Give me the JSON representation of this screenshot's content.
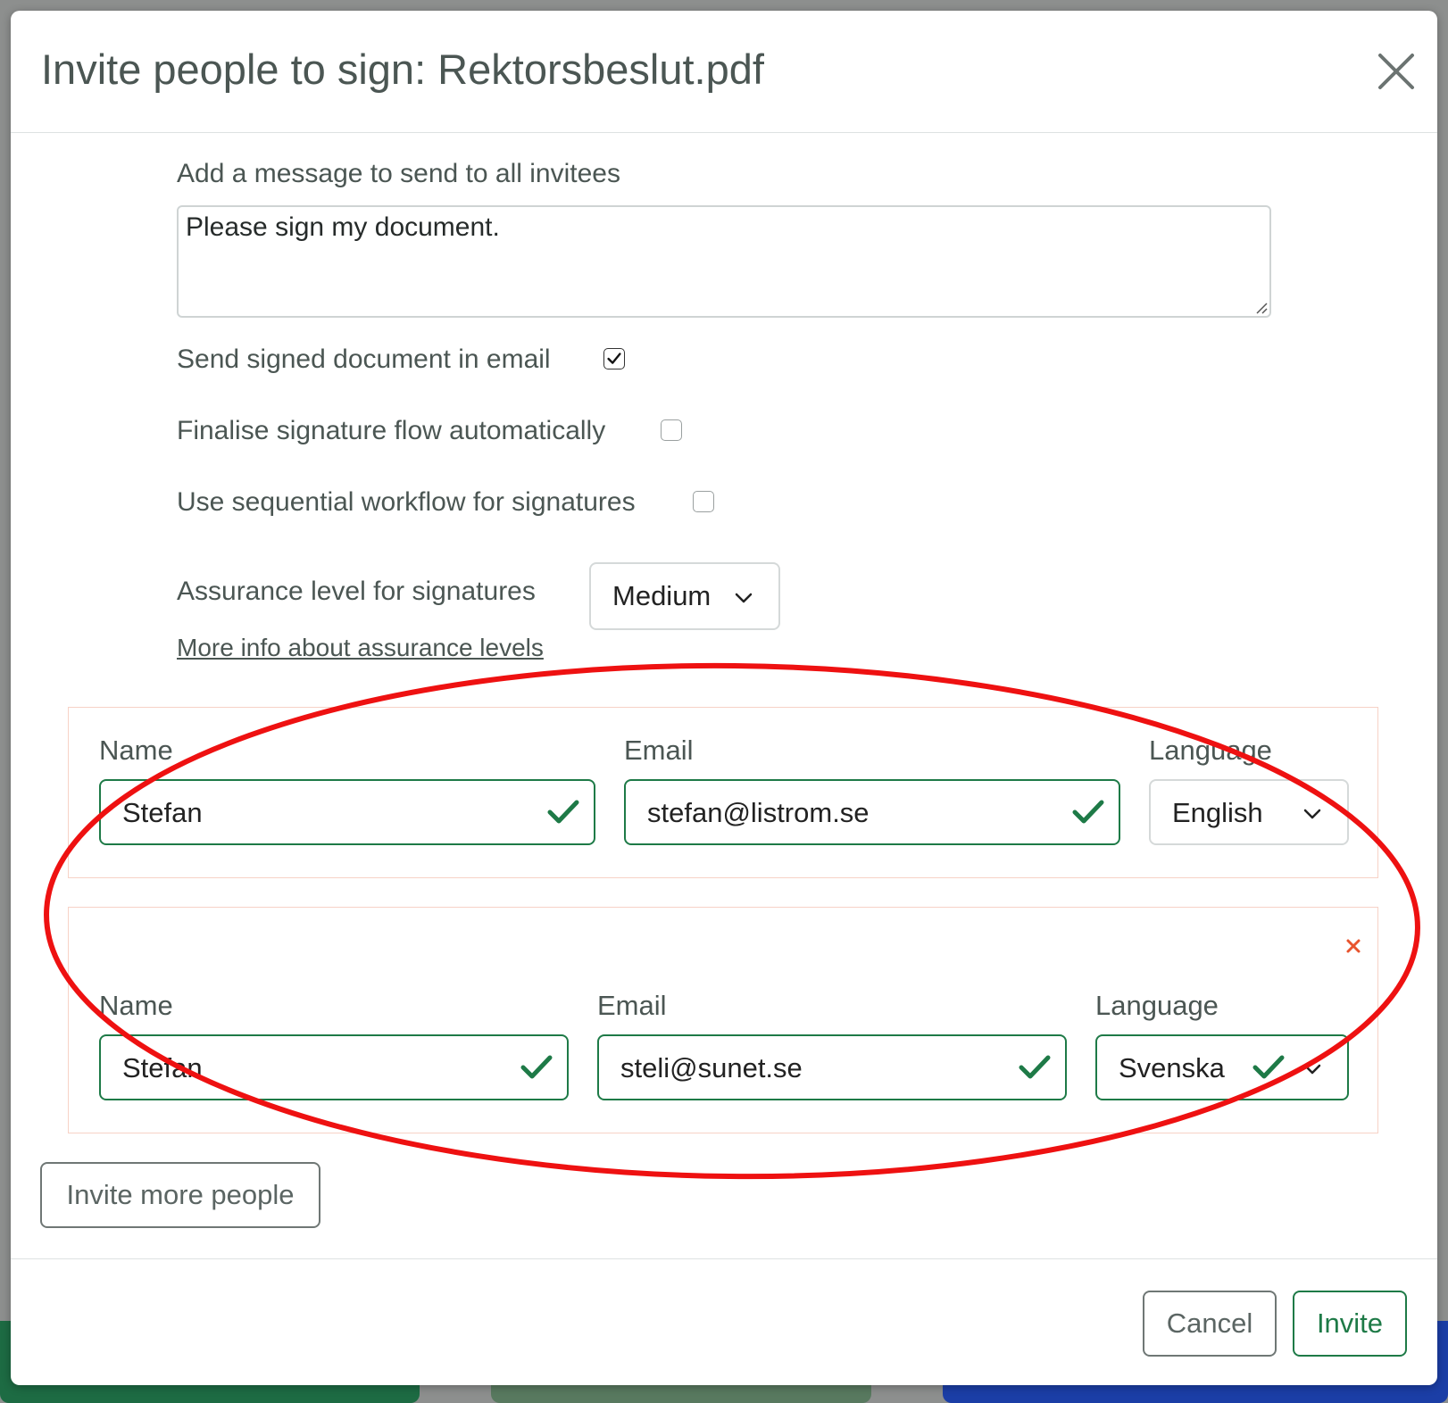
{
  "dialog": {
    "title": "Invite people to sign: Rektorsbeslut.pdf",
    "close_icon": "close-icon"
  },
  "message": {
    "label": "Add a message to send to all invitees",
    "value": "Please sign my document."
  },
  "options": {
    "send_signed_label": "Send signed document in email",
    "send_signed_checked": true,
    "finalise_label": "Finalise signature flow automatically",
    "finalise_checked": false,
    "sequential_label": "Use sequential workflow for signatures",
    "sequential_checked": false
  },
  "assurance": {
    "label": "Assurance level for signatures",
    "value": "Medium",
    "more_info_link": "More info about assurance levels"
  },
  "invitees": [
    {
      "name_label": "Name",
      "name": "Stefan",
      "email_label": "Email",
      "email": "stefan@listrom.se",
      "language_label": "Language",
      "language": "English"
    },
    {
      "name_label": "Name",
      "name": "Stefan",
      "email_label": "Email",
      "email": "steli@sunet.se",
      "language_label": "Language",
      "language": "Svenska",
      "remove_icon": "remove-x-icon"
    }
  ],
  "buttons": {
    "invite_more": "Invite more people",
    "cancel": "Cancel",
    "invite": "Invite"
  },
  "colors": {
    "valid_green": "#1e7a47",
    "annotation_red": "#ee1111",
    "remove_red": "#e8542e"
  }
}
